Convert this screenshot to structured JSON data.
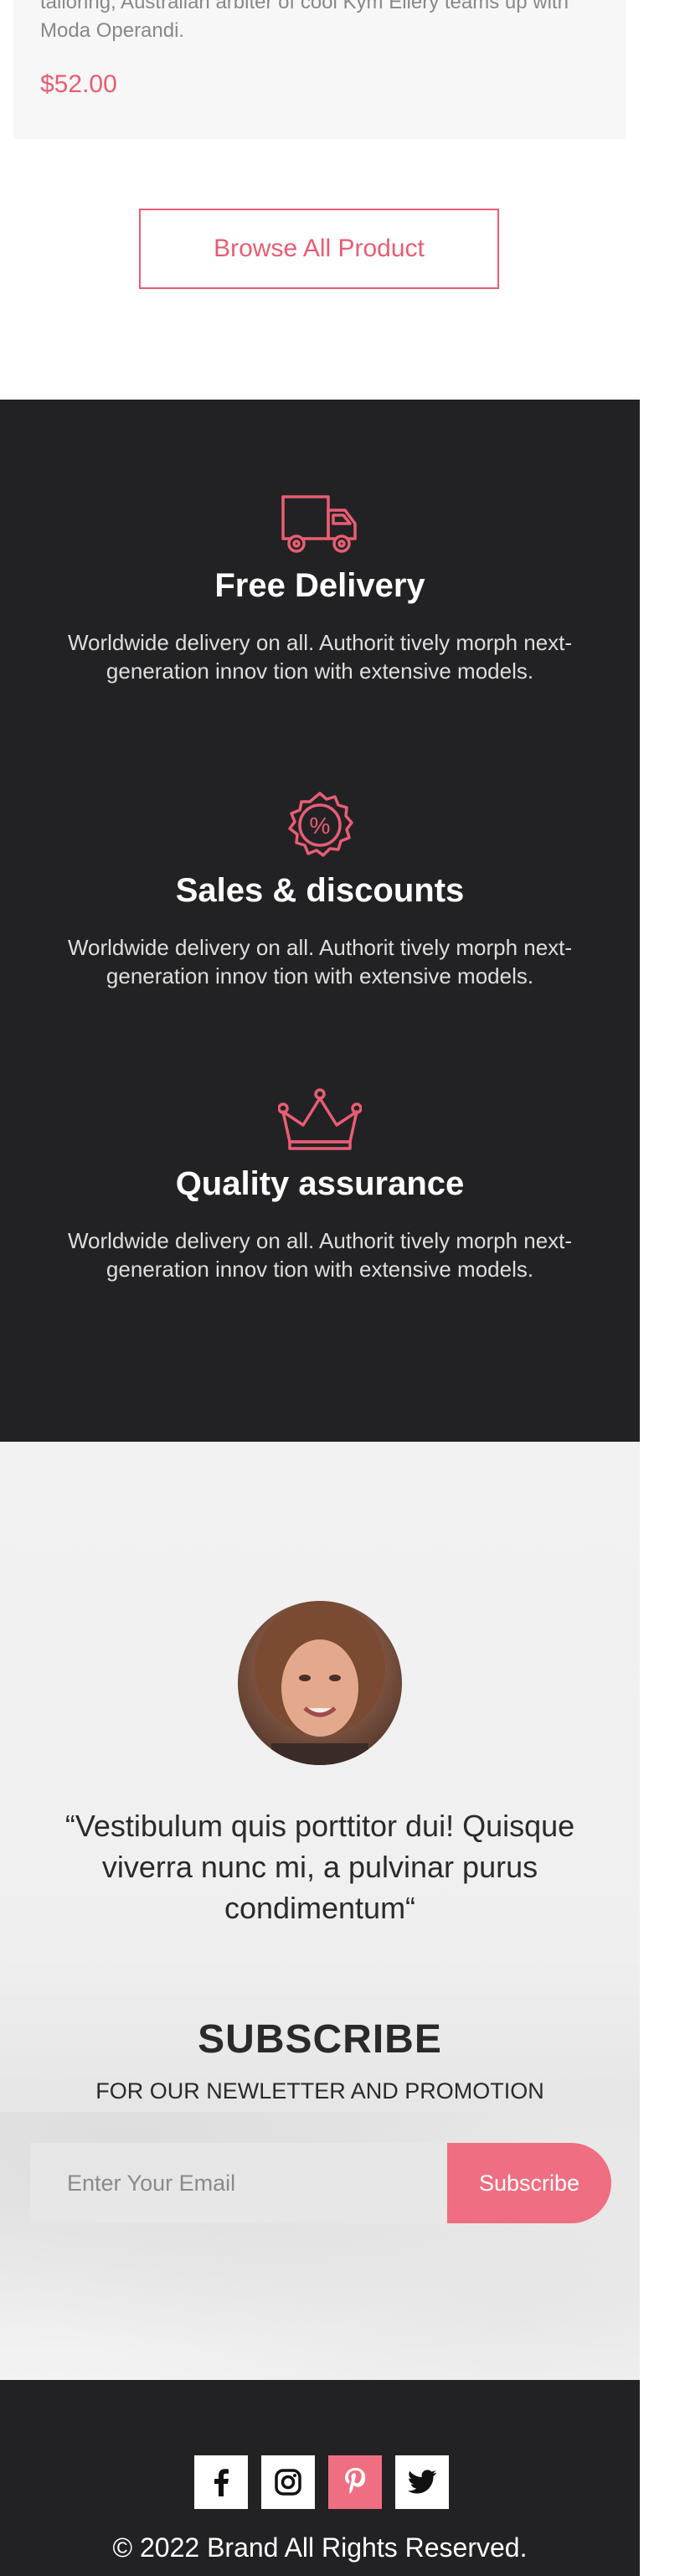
{
  "product": {
    "description": "tailoring, Australian arbiter of cool Kym Ellery teams up with Moda Operandi.",
    "price": "$52.00"
  },
  "browse_button": {
    "label": "Browse All Product"
  },
  "features": [
    {
      "icon": "truck-icon",
      "title": "Free Delivery",
      "text": "Worldwide delivery on all. Authorit tively morph next-generation innov tion with extensive models."
    },
    {
      "icon": "percent-badge-icon",
      "title": "Sales & discounts",
      "text": "Worldwide delivery on all. Authorit tively morph next-generation innov tion with extensive models."
    },
    {
      "icon": "crown-icon",
      "title": "Quality assurance",
      "text": "Worldwide delivery on all. Authorit tively morph next-generation innov tion with extensive models."
    }
  ],
  "testimonial": {
    "quote": "“Vestibulum quis porttitor dui! Quisque viverra nunc mi, a pulvinar purus condimentum“"
  },
  "subscribe": {
    "title": "SUBSCRIBE",
    "caption": "FOR OUR NEWLETTER AND PROMOTION",
    "placeholder": "Enter Your Email",
    "button_label": "Subscribe"
  },
  "footer": {
    "socials": [
      {
        "icon": "facebook-icon",
        "active": false
      },
      {
        "icon": "instagram-icon",
        "active": false
      },
      {
        "icon": "pinterest-icon",
        "active": true
      },
      {
        "icon": "twitter-icon",
        "active": false
      }
    ],
    "copyright": "© 2022 Brand All Rights Reserved."
  },
  "colors": {
    "accent": "#e95d73",
    "dark_section": "#222224",
    "subscribe_button": "#f06e81"
  }
}
